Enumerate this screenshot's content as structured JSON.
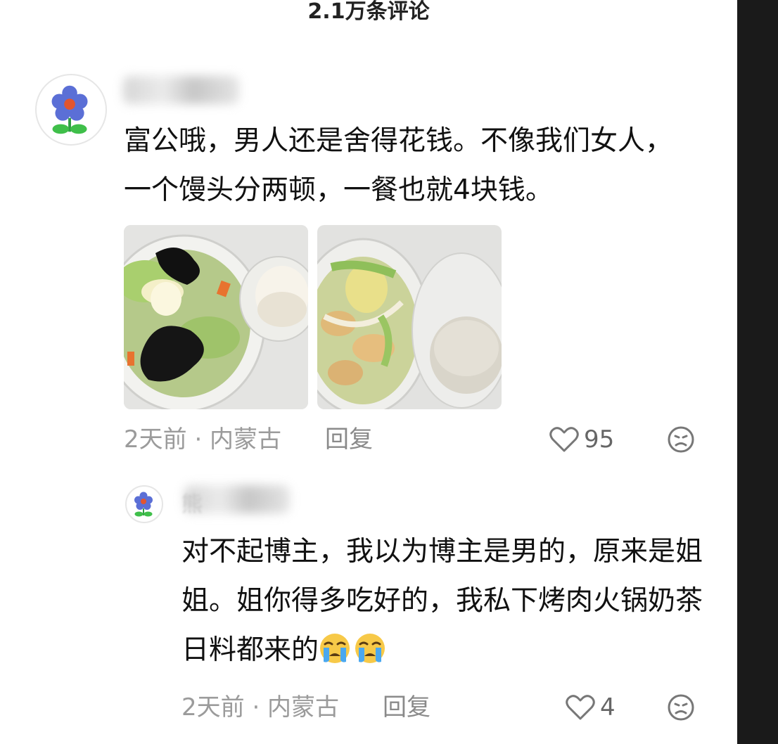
{
  "header": {
    "title": "2.1万条评论"
  },
  "comments": [
    {
      "avatar_icon": "blue-flower-icon",
      "text": "富公哦，男人还是舍得花钱。不像我们女人，一个馒头分两顿，一餐也就4块钱。",
      "images": [
        {
          "description_icon": "vegetable-bowl-with-mantou-photo"
        },
        {
          "description_icon": "stirfry-bowl-with-mantou-photo"
        }
      ],
      "time_location": "2天前 · 内蒙古",
      "reply_label": "回复",
      "likes": "95"
    },
    {
      "avatar_icon": "blue-flower-icon",
      "name_partial": "熊",
      "text": "对不起博主，我以为博主是男的，原来是姐姐。姐你得多吃好的，我私下烤肉火锅奶茶日料都来的",
      "emoji": [
        "crying-face-icon",
        "crying-face-icon"
      ],
      "time_location": "2天前 · 内蒙古",
      "reply_label": "回复",
      "likes": "4"
    }
  ],
  "colors": {
    "text": "#111111",
    "meta": "#9b9b9b",
    "accent_flower": "#5b6fd6"
  }
}
